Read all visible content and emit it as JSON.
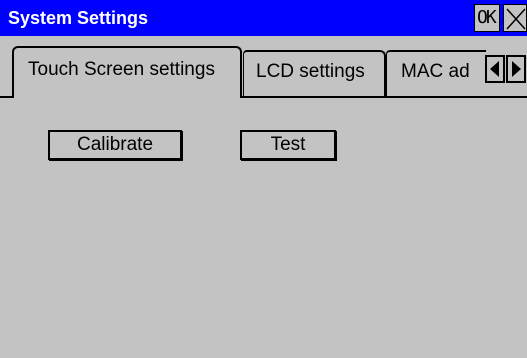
{
  "window": {
    "title": "System Settings",
    "ok_label": "OK"
  },
  "tabs": [
    {
      "label": "Touch Screen settings",
      "active": true
    },
    {
      "label": "LCD settings",
      "active": false
    },
    {
      "label": "MAC ad",
      "active": false
    }
  ],
  "touch_screen": {
    "calibrate_label": "Calibrate",
    "test_label": "Test"
  },
  "colors": {
    "titlebar": "#0000ff",
    "background": "#c3c3c3"
  }
}
